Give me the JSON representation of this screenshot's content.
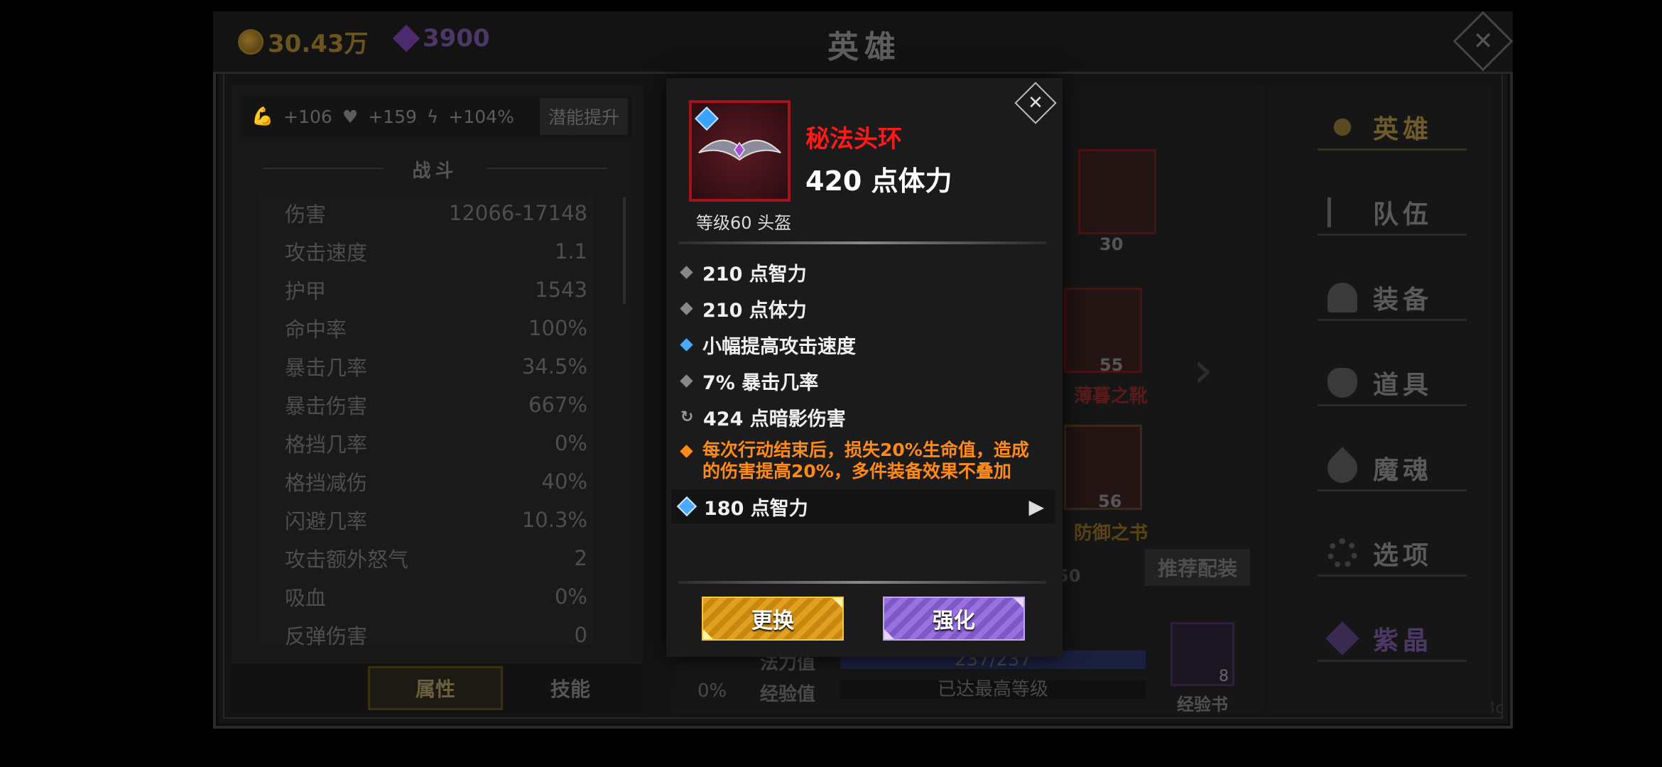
{
  "resources": {
    "gold": "30.43万",
    "gems": "3900"
  },
  "title": "英雄",
  "left": {
    "bonuses": {
      "strength": "+106",
      "health": "+159",
      "speed": "+104%"
    },
    "potential_btn": "潜能提升",
    "section": "战斗",
    "stats": [
      {
        "label": "伤害",
        "value": "12066-17148"
      },
      {
        "label": "攻击速度",
        "value": "1.1"
      },
      {
        "label": "护甲",
        "value": "1543"
      },
      {
        "label": "命中率",
        "value": "100%"
      },
      {
        "label": "暴击几率",
        "value": "34.5%"
      },
      {
        "label": "暴击伤害",
        "value": "667%"
      },
      {
        "label": "格挡几率",
        "value": "0%"
      },
      {
        "label": "格挡减伤",
        "value": "40%"
      },
      {
        "label": "闪避几率",
        "value": "10.3%"
      },
      {
        "label": "攻击额外怒气",
        "value": "2"
      },
      {
        "label": "吸血",
        "value": "0%"
      },
      {
        "label": "反弹伤害",
        "value": "0"
      }
    ],
    "tabs": [
      "属性",
      "技能"
    ]
  },
  "middle": {
    "slot_top_level": "30",
    "slot_boots_level": "55",
    "slot_boots_name": "薄暮之靴",
    "slot_book_level": "56",
    "slot_book_name": "防御之书",
    "recommend_btn": "推荐配装",
    "hp_tail": "50",
    "mana_label": "法力值",
    "mana_value": "237/237",
    "exp_label": "经验值",
    "exp_value": "已达最高等级",
    "pct": "0%",
    "exp_book_label": "经验书",
    "exp_book_count": "8",
    "id_text": "f9083528b-da94-412e-ac8c"
  },
  "nav": [
    "英雄",
    "队伍",
    "装备",
    "道具",
    "魔魂",
    "选项",
    "紫晶"
  ],
  "popup": {
    "name": "秘法头环",
    "main_stat": "420 点体力",
    "level": "等级60 头盔",
    "attrs": [
      {
        "text": "210 点智力",
        "kind": "grey"
      },
      {
        "text": "210 点体力",
        "kind": "grey"
      },
      {
        "text": "小幅提高攻击速度",
        "kind": "blue"
      },
      {
        "text": "7% 暴击几率",
        "kind": "grey"
      },
      {
        "text": "424 点暗影伤害",
        "kind": "refresh"
      }
    ],
    "special_line1": "每次行动结束后，损失20%生命值，造成",
    "special_line2": "的伤害提高20%，多件装备效果不叠加",
    "gem_text": "180 点智力",
    "btn_replace": "更换",
    "btn_enhance": "强化"
  },
  "colors": {
    "name_red": "#ff1a1a",
    "special_orange": "#ff8a1a",
    "gold_btn": "#e0a020",
    "purple_btn": "#9a72e0"
  }
}
